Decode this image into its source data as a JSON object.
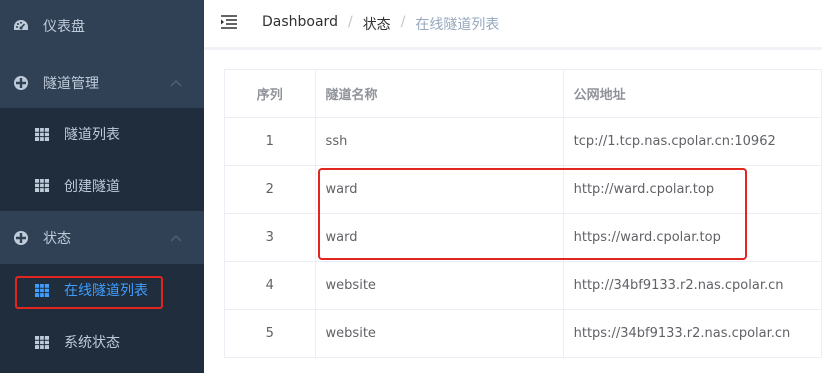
{
  "sidebar": {
    "items": [
      {
        "label": "仪表盘",
        "icon": "dashboard-icon"
      },
      {
        "label": "隧道管理",
        "icon": "tunnel-manage-icon"
      },
      {
        "label": "隧道列表",
        "icon": "grid-icon"
      },
      {
        "label": "创建隧道",
        "icon": "grid-icon"
      },
      {
        "label": "状态",
        "icon": "status-icon"
      },
      {
        "label": "在线隧道列表",
        "icon": "grid-icon"
      },
      {
        "label": "系统状态",
        "icon": "grid-icon"
      }
    ]
  },
  "header": {
    "breadcrumb": [
      "Dashboard",
      "状态",
      "在线隧道列表"
    ],
    "separator": "/"
  },
  "table": {
    "columns": [
      "序列",
      "隧道名称",
      "公网地址"
    ],
    "rows": [
      {
        "seq": "1",
        "name": "ssh",
        "url": "tcp://1.tcp.nas.cpolar.cn:10962"
      },
      {
        "seq": "2",
        "name": "ward",
        "url": "http://ward.cpolar.top"
      },
      {
        "seq": "3",
        "name": "ward",
        "url": "https://ward.cpolar.top"
      },
      {
        "seq": "4",
        "name": "website",
        "url": "http://34bf9133.r2.nas.cpolar.cn"
      },
      {
        "seq": "5",
        "name": "website",
        "url": "https://34bf9133.r2.nas.cpolar.cn"
      }
    ]
  },
  "colors": {
    "sidebar_bg": "#304156",
    "submenu_bg": "#1f2d3d",
    "active": "#409eff",
    "highlight": "#e0261f"
  }
}
